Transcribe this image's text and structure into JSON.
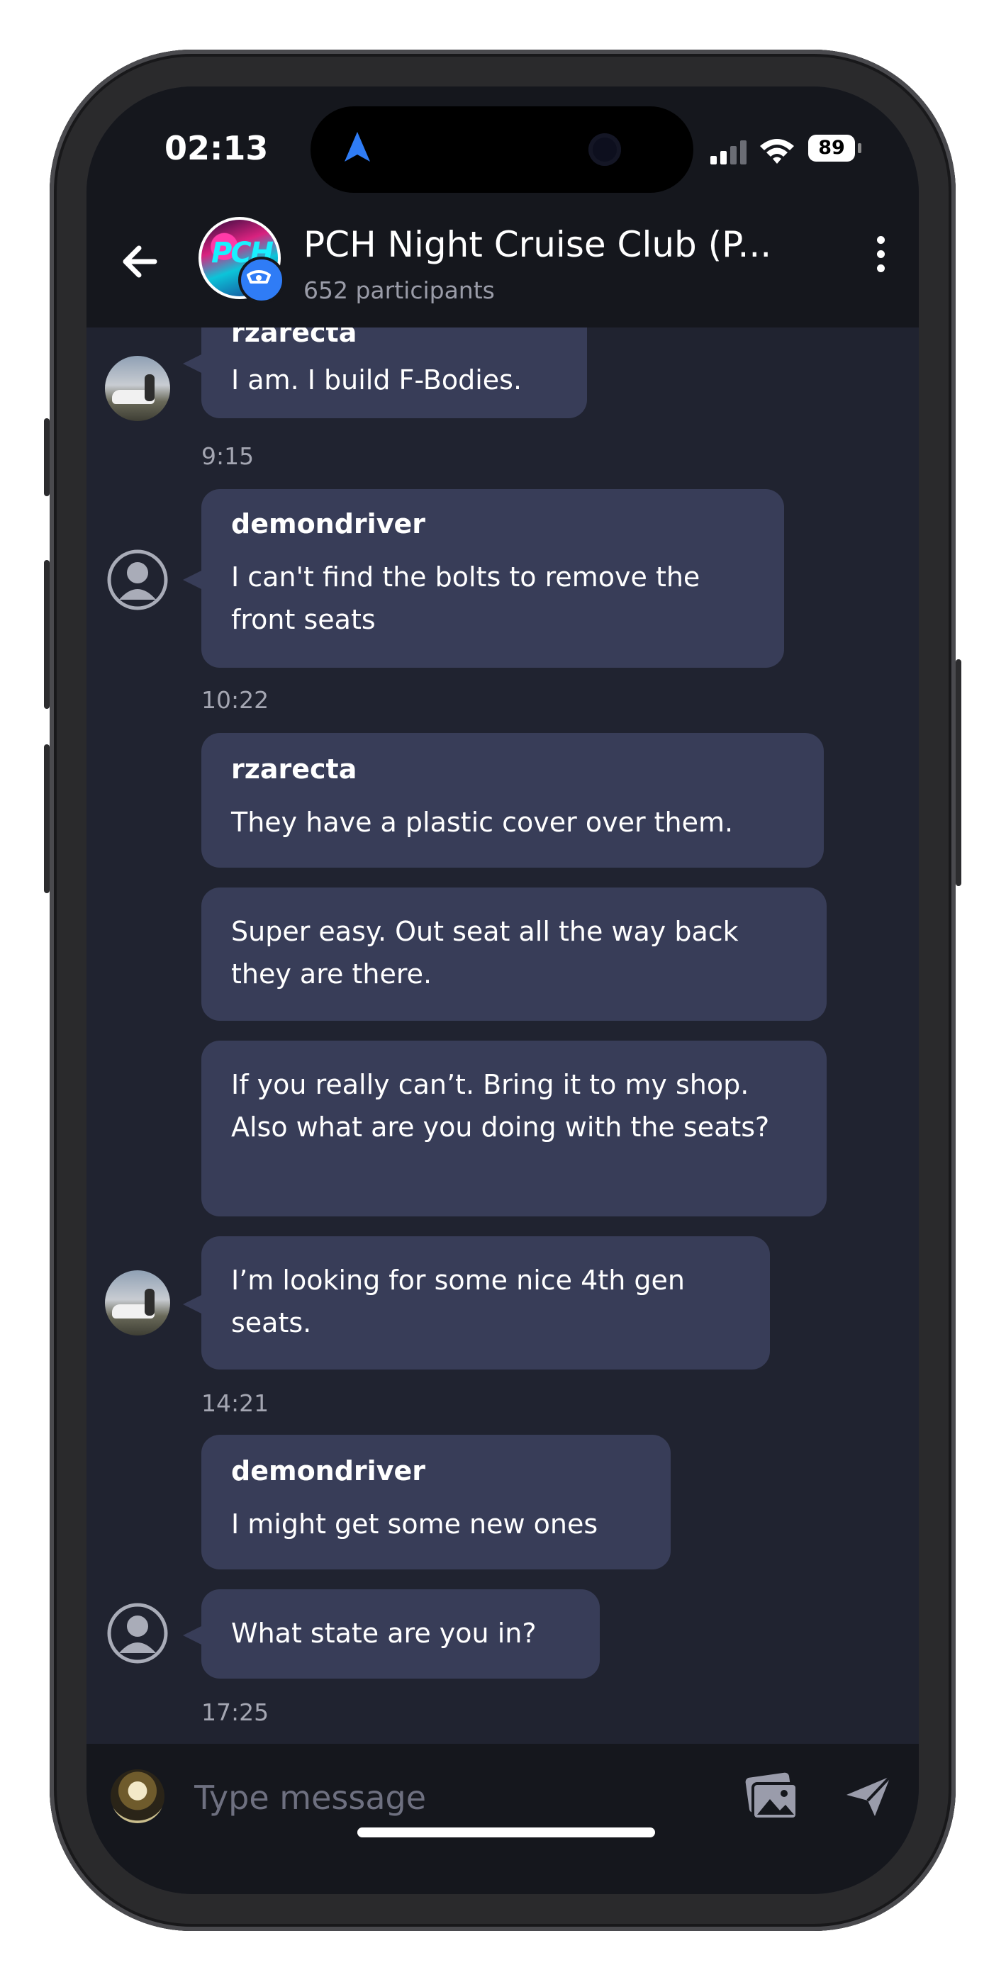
{
  "status_bar": {
    "time": "02:13",
    "battery": "89"
  },
  "header": {
    "title": "PCH Night Cruise Club (P...",
    "subtitle": "652 participants",
    "avatar_text": "PCH"
  },
  "messages": {
    "partial_sender": "rzarecta",
    "m1": "I am. I build F-Bodies.",
    "t1": "9:15",
    "m2_sender": "demondriver",
    "m2": "I can't find the bolts to remove the front seats",
    "t2": "10:22",
    "m3_sender": "rzarecta",
    "m3": "They have a plastic cover over them.",
    "m4": "Super easy. Out seat all the way back they are there.",
    "m5": "If you really can’t. Bring it to my shop. Also what are you doing with the seats?",
    "m6": "I’m looking for some nice 4th gen seats.",
    "t3": "14:21",
    "m7_sender": "demondriver",
    "m7": "I might get some new ones",
    "m8": "What state are you in?",
    "t4": "17:25"
  },
  "composer": {
    "placeholder": "Type message"
  },
  "colors": {
    "background": "#202330",
    "bar": "#15171d",
    "bubble": "#383d58",
    "accent": "#2f7cf6"
  },
  "icons": [
    "location-arrow-icon",
    "signal-icon",
    "wifi-icon",
    "back-arrow-icon",
    "admin-badge-icon",
    "more-vertical-icon",
    "user-placeholder-icon",
    "image-icon",
    "send-icon"
  ]
}
